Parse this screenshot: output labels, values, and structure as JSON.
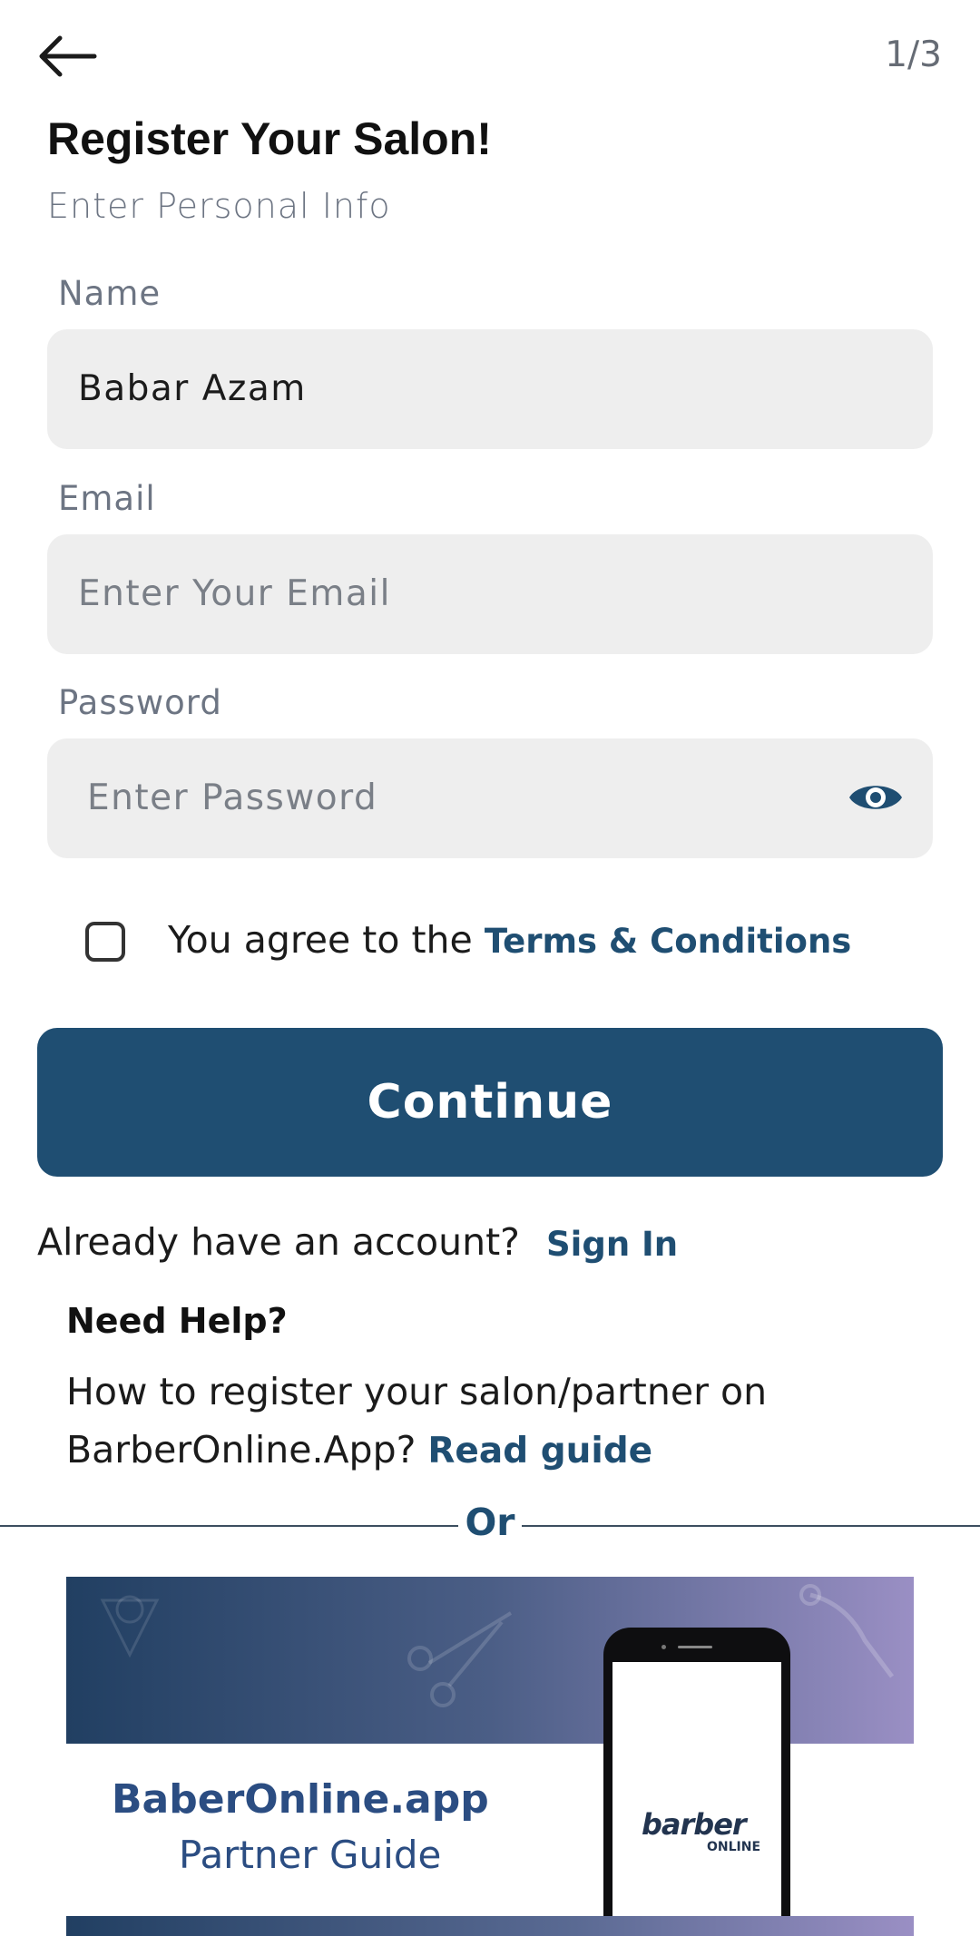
{
  "header": {
    "step": "1/3",
    "title": "Register Your Salon!",
    "subtitle": "Enter Personal Info"
  },
  "form": {
    "name": {
      "label": "Name",
      "value": "Babar Azam"
    },
    "email": {
      "label": "Email",
      "placeholder": "Enter Your Email"
    },
    "password": {
      "label": "Password",
      "placeholder": "Enter Password"
    }
  },
  "terms": {
    "prefix": "You agree to the ",
    "link": "Terms & Conditions",
    "checked": false
  },
  "continue_label": "Continue",
  "signin": {
    "prompt": "Already have an account?",
    "link": "Sign In"
  },
  "help": {
    "heading": "Need Help?",
    "body": "How to register your salon/partner on BarberOnline.App?",
    "link": "Read guide"
  },
  "divider": {
    "label": "Or"
  },
  "banner": {
    "brand": "BaberOnline.app",
    "subtitle": "Partner Guide",
    "logo_text": "barber",
    "logo_sub": "ONLINE"
  },
  "colors": {
    "primary": "#1f4e72",
    "field_bg": "#eeeeee",
    "muted": "#6d7583"
  },
  "icons": {
    "back": "arrow-left-icon",
    "visibility": "eye-icon",
    "checkbox": "checkbox-unchecked-icon"
  }
}
